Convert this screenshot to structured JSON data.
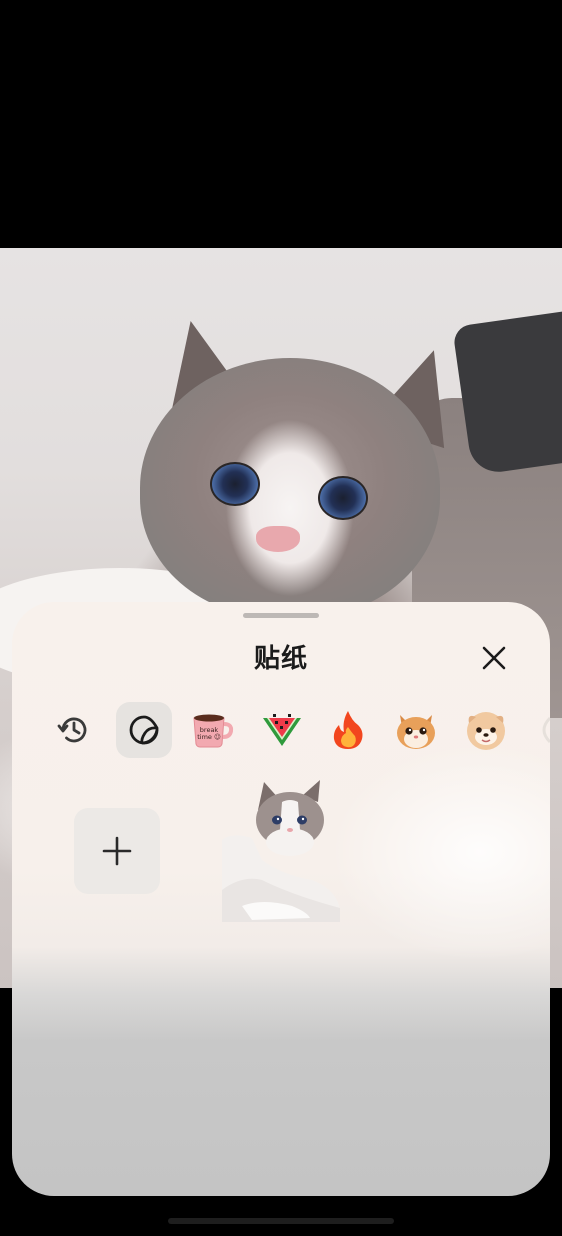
{
  "sheet": {
    "title": "贴纸",
    "close_icon": "close-icon",
    "add_icon": "plus-icon"
  },
  "tabs": [
    {
      "icon": "history-icon",
      "active": false
    },
    {
      "icon": "sticker-icon",
      "active": true
    },
    {
      "icon": "coffee-cup-sticker-icon",
      "active": false,
      "text": "break time"
    },
    {
      "icon": "watermelon-sticker-icon",
      "active": false
    },
    {
      "icon": "fire-sticker-icon",
      "active": false
    },
    {
      "icon": "cat-face-sticker-icon",
      "active": false
    },
    {
      "icon": "dog-face-sticker-icon",
      "active": false
    }
  ],
  "colors": {
    "sheet_top": "#f8f1ec",
    "sheet_bottom": "#c4c4c4",
    "active_tab": "#e6e3e0",
    "add_button": "#ece9e6",
    "text": "#1b1b1b"
  }
}
